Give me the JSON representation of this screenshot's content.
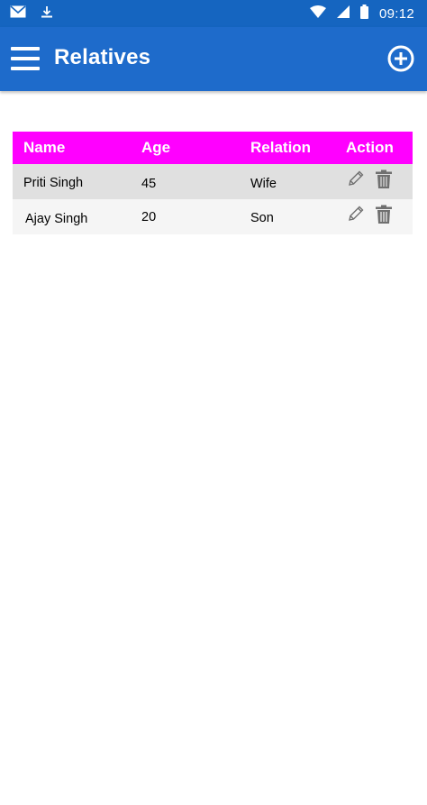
{
  "status_bar": {
    "time": "09:12",
    "icons": [
      "mail-icon",
      "download-icon",
      "wifi-icon",
      "signal-icon",
      "battery-icon"
    ]
  },
  "app_bar": {
    "title": "Relatives",
    "menu_icon": "hamburger-menu-icon",
    "add_icon": "add-circle-icon",
    "color": "#1e6bcb"
  },
  "table": {
    "header_color": "#ff00ff",
    "columns": [
      "Name",
      "Age",
      "Relation",
      "Action"
    ],
    "rows": [
      {
        "name": "Priti Singh",
        "age": "45",
        "relation": "Wife"
      },
      {
        "name": "Ajay Singh",
        "age": "20",
        "relation": "Son"
      }
    ],
    "action_icons": [
      "edit-pencil-icon",
      "delete-trash-icon"
    ]
  }
}
